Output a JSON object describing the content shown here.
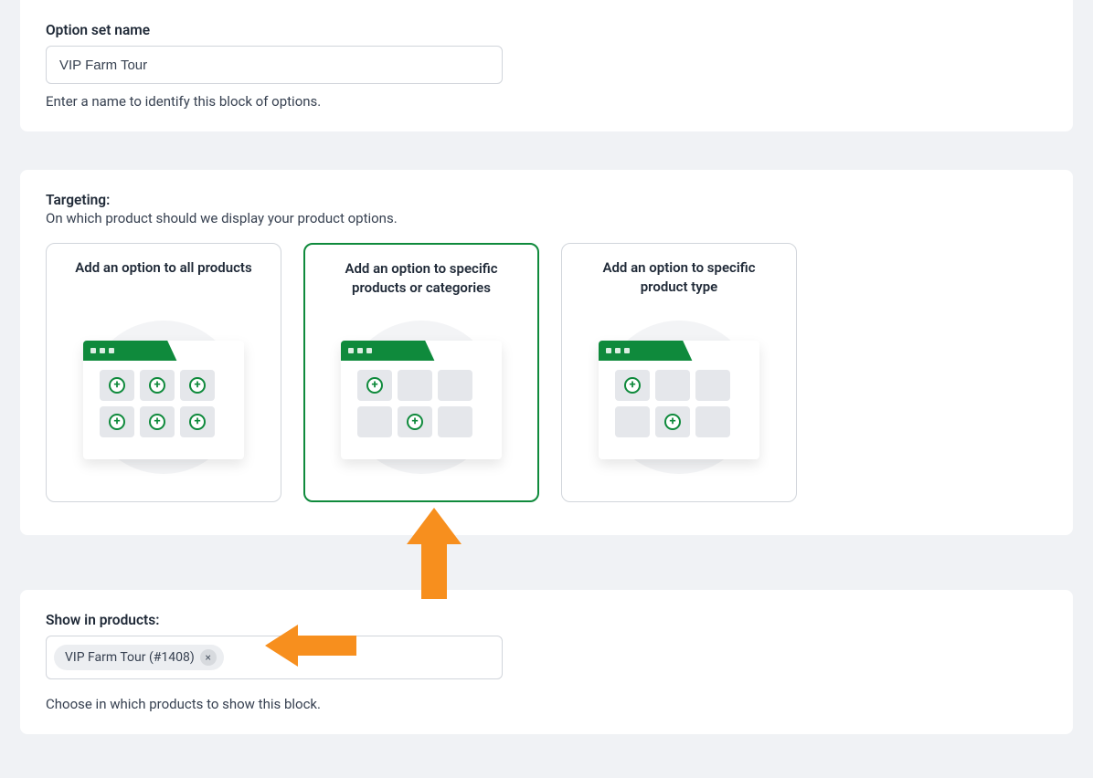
{
  "optionSet": {
    "label": "Option set name",
    "value": "VIP Farm Tour",
    "help": "Enter a name to identify this block of options."
  },
  "targeting": {
    "title": "Targeting:",
    "subtitle": "On which product should we display your product options.",
    "cards": [
      {
        "title": "Add an option to all products",
        "plusIndexes": [
          0,
          1,
          2,
          3,
          4,
          5
        ],
        "selected": false
      },
      {
        "title": "Add an option to specific products or categories",
        "plusIndexes": [
          0,
          4
        ],
        "selected": true
      },
      {
        "title": "Add an option to specific product type",
        "plusIndexes": [
          0,
          4
        ],
        "selected": false
      }
    ]
  },
  "products": {
    "label": "Show in products:",
    "chips": [
      {
        "label": "VIP Farm Tour (#1408)"
      }
    ],
    "help": "Choose in which products to show this block."
  },
  "annotations": {
    "arrowDownColor": "#f78f1e",
    "arrowLeftColor": "#f78f1e"
  }
}
